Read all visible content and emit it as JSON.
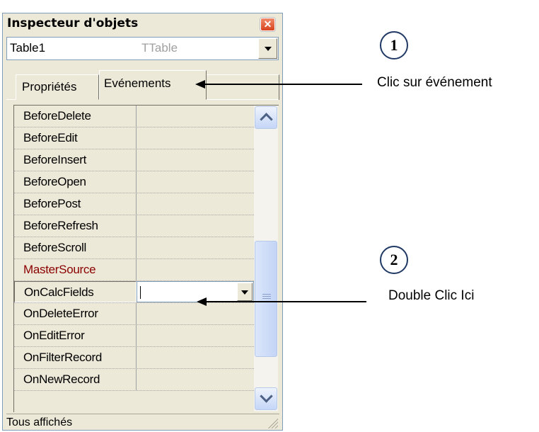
{
  "window": {
    "title": "Inspecteur d'objets",
    "close_glyph": "✕",
    "object_selector": {
      "name": "Table1",
      "type": "TTable"
    },
    "tabs": [
      {
        "label": "Propriétés",
        "active": false
      },
      {
        "label": "Evénements",
        "active": true
      }
    ],
    "events": [
      {
        "name": "BeforeDelete",
        "value": ""
      },
      {
        "name": "BeforeEdit",
        "value": ""
      },
      {
        "name": "BeforeInsert",
        "value": ""
      },
      {
        "name": "BeforeOpen",
        "value": ""
      },
      {
        "name": "BeforePost",
        "value": ""
      },
      {
        "name": "BeforeRefresh",
        "value": ""
      },
      {
        "name": "BeforeScroll",
        "value": ""
      },
      {
        "name": "MasterSource",
        "value": ""
      },
      {
        "name": "OnCalcFields",
        "value": ""
      },
      {
        "name": "OnDeleteError",
        "value": ""
      },
      {
        "name": "OnEditError",
        "value": ""
      },
      {
        "name": "OnFilterRecord",
        "value": ""
      },
      {
        "name": "OnNewRecord",
        "value": ""
      }
    ],
    "selected_row": "OnCalcFields",
    "status": "Tous affichés"
  },
  "annotations": [
    {
      "number": "1",
      "text": "Clic sur événement"
    },
    {
      "number": "2",
      "text": "Double Clic Ici"
    }
  ],
  "colors": {
    "highlight_row_text": "#8b0000",
    "badge_border": "#1f3864"
  }
}
